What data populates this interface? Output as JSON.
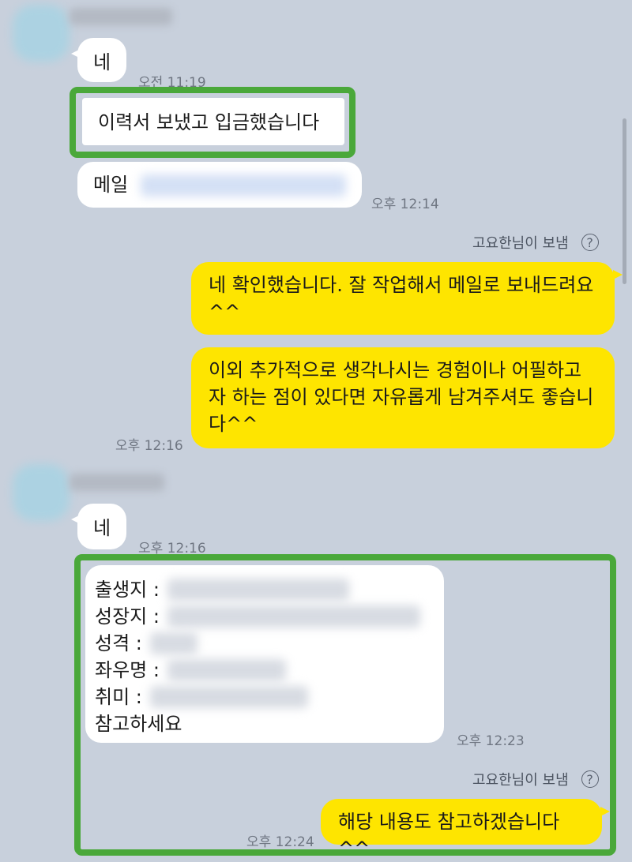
{
  "messages": {
    "m1": {
      "text": "네",
      "time": "오전 11:19"
    },
    "m2": {
      "text": "이력서 보냈고 입금했습니다"
    },
    "m3": {
      "label": "메일",
      "time": "오후 12:14"
    },
    "sender1": {
      "text": "고요한님이 보냄"
    },
    "m4": {
      "text": "네 확인했습니다. 잘 작업해서 메일로 보내드려요^^"
    },
    "m5": {
      "text": "이외 추가적으로 생각나시는 경험이나 어필하고자 하는 점이 있다면 자유롭게 남겨주셔도 좋습니다^^",
      "time": "오후 12:16"
    },
    "m6": {
      "text": "네",
      "time": "오후 12:16"
    },
    "m7": {
      "rows": [
        "출생지 :",
        "성장지 :",
        "성격 :",
        "좌우명 :",
        "취미 :"
      ],
      "last": "참고하세요",
      "time": "오후 12:23"
    },
    "sender2": {
      "text": "고요한님이 보냄"
    },
    "m8": {
      "text": "해당 내용도 참고하겠습니다^^",
      "time": "오후 12:24"
    }
  },
  "icons": {
    "help": "question-circle-icon"
  },
  "colors": {
    "background": "#c8d0dc",
    "outgoing": "#fee500",
    "incoming": "#ffffff",
    "highlight": "#4aa83a"
  }
}
